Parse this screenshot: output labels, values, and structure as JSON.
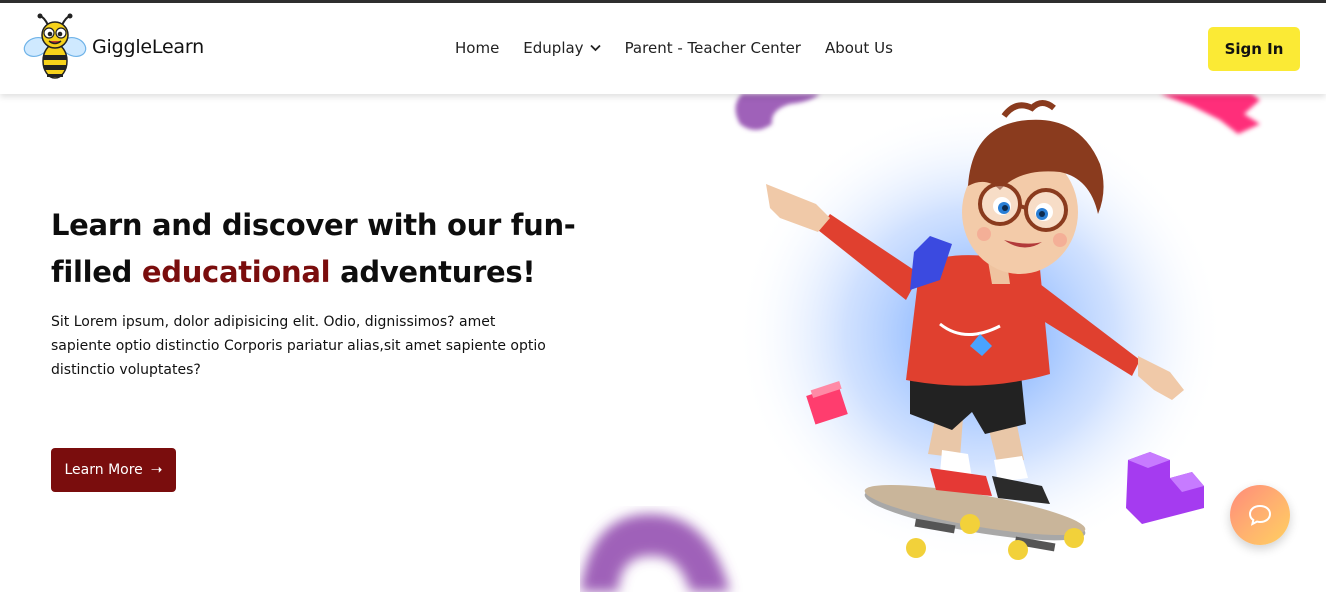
{
  "brand": {
    "name": "GiggleLearn",
    "logo_icon": "bee-icon"
  },
  "nav": {
    "items": [
      {
        "label": "Home"
      },
      {
        "label": "Eduplay",
        "has_dropdown": true
      },
      {
        "label": "Parent - Teacher Center"
      },
      {
        "label": "About Us"
      }
    ]
  },
  "header": {
    "signin_label": "Sign In"
  },
  "hero": {
    "headline_part1": "Learn and discover with our fun-filled",
    "headline_accent": "educational",
    "headline_part2": "adventures!",
    "description": "Sit Lorem ipsum, dolor adipisicing elit. Odio, dignissimos? amet sapiente optio distinctio Corporis pariatur alias,sit amet sapiente optio distinctio voluptates?",
    "cta_label": "Learn More",
    "cta_icon": "arrow-right-icon",
    "illustration": "skateboarding-boy-illustration"
  },
  "chat": {
    "icon": "chat-bubble-icon"
  },
  "colors": {
    "accent": "#7a0d0d",
    "signin_bg": "#fbea35",
    "text": "#111111",
    "purple": "#9b59d8",
    "pink": "#ff2f7a"
  }
}
